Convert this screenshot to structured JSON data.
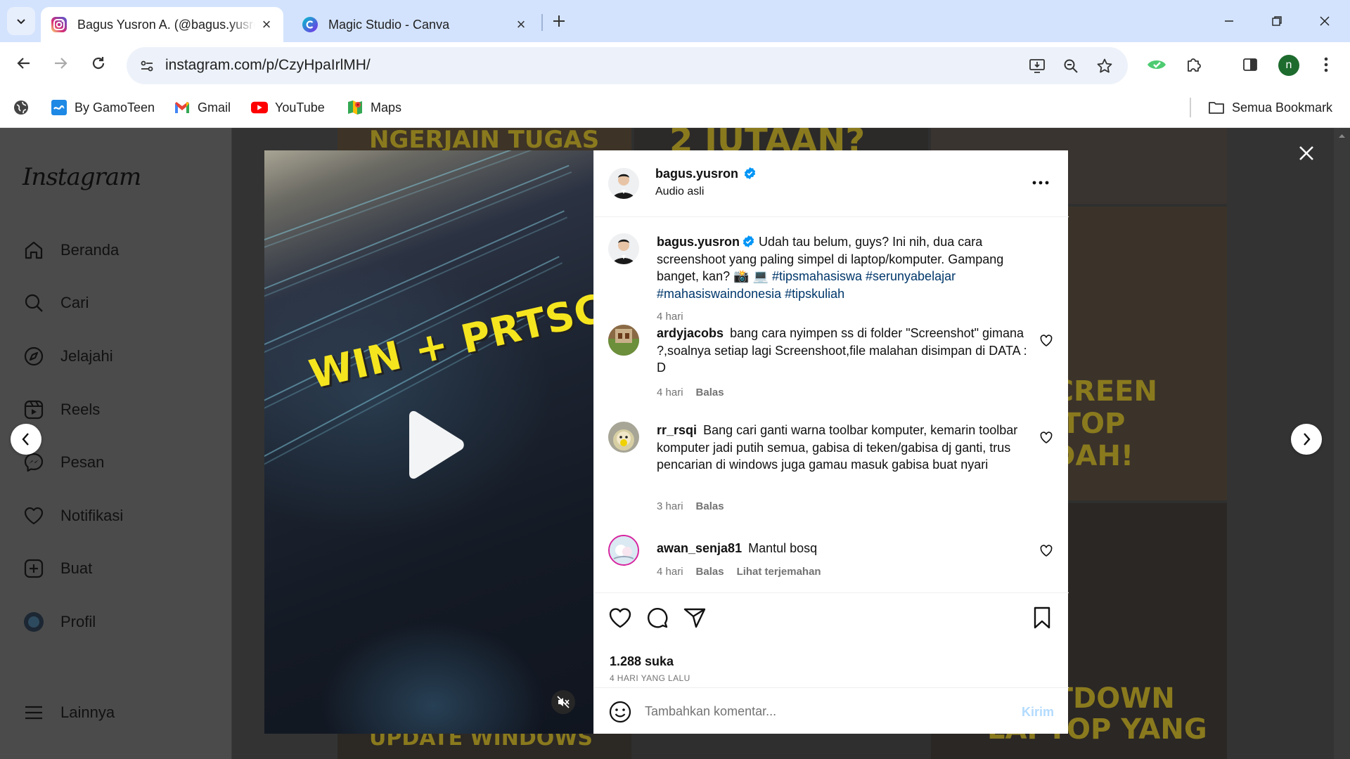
{
  "browser": {
    "tabs": [
      {
        "title": "Bagus Yusron A. (@bagus.yusron)",
        "icon": "instagram-icon",
        "active": true
      },
      {
        "title": "Magic Studio - Canva",
        "icon": "canva-icon",
        "active": false
      }
    ],
    "url": "instagram.com/p/CzyHpaIrlMH/",
    "profile_initial": "n",
    "bookmarks": [
      {
        "label": "By GamoTeen",
        "icon": "gamoteen-icon"
      },
      {
        "label": "Gmail",
        "icon": "gmail-icon"
      },
      {
        "label": "YouTube",
        "icon": "youtube-icon"
      },
      {
        "label": "Maps",
        "icon": "maps-icon"
      }
    ],
    "all_bookmarks_label": "Semua Bookmark"
  },
  "sidebar": {
    "logo": "Instagram",
    "items": [
      {
        "label": "Beranda",
        "icon": "home-icon"
      },
      {
        "label": "Cari",
        "icon": "search-icon"
      },
      {
        "label": "Jelajahi",
        "icon": "explore-compass-icon"
      },
      {
        "label": "Reels",
        "icon": "reels-icon"
      },
      {
        "label": "Pesan",
        "icon": "messenger-icon"
      },
      {
        "label": "Notifikasi",
        "icon": "heart-icon"
      },
      {
        "label": "Buat",
        "icon": "create-plus-icon"
      },
      {
        "label": "Profil",
        "icon": "profile-avatar-icon"
      }
    ],
    "more_label": "Lainnya"
  },
  "background_thumbs": [
    {
      "text": "NGERJAIN TUGAS"
    },
    {
      "text": "2 JUTAAN?"
    },
    {
      "text": "A SCREEN\nLAPTOP\nMUDAH!"
    },
    {
      "text": "SHUTDOWN\nLAPTOP YANG"
    },
    {
      "text": "UPDATE WINDOWS"
    }
  ],
  "post": {
    "media": {
      "overlay_text": "WIN + PRTSC"
    },
    "header": {
      "username": "bagus.yusron",
      "verified": true,
      "subtitle": "Audio asli"
    },
    "caption": {
      "username": "bagus.yusron",
      "text": "Udah tau belum, guys? Ini nih, dua cara screenshoot yang paling simpel di laptop/komputer. Gampang banget, kan? 📸 💻",
      "hashtags": "#tipsmahasiswa #serunyabelajar #mahasiswaindonesia #tipskuliah",
      "time": "4 hari"
    },
    "comments": [
      {
        "username": "ardyjacobs",
        "text": "bang cara nyimpen ss di folder \"Screenshot\" gimana ?,soalnya setiap lagi Screenshoot,file malahan disimpan di DATA : D",
        "time": "4 hari",
        "reply": "Balas"
      },
      {
        "username": "rr_rsqi",
        "text": "Bang cari ganti warna toolbar komputer, kemarin toolbar komputer jadi putih semua, gabisa di teken/gabisa dj ganti, trus pencarian di windows juga gamau masuk gabisa buat nyari",
        "time": "3 hari",
        "reply": "Balas"
      },
      {
        "username": "awan_senja81",
        "text": "Mantul bosq",
        "time": "4 hari",
        "reply": "Balas",
        "extra": "Lihat terjemahan"
      }
    ],
    "likes": "1.288 suka",
    "posted_ago": "4 HARI YANG LALU",
    "composer": {
      "placeholder": "Tambahkan komentar...",
      "post_label": "Kirim"
    }
  },
  "colors": {
    "link": "#00376b",
    "verified": "#0095f6",
    "post_disabled": "#b3dbff",
    "accent_yellow": "#f5e51f"
  }
}
